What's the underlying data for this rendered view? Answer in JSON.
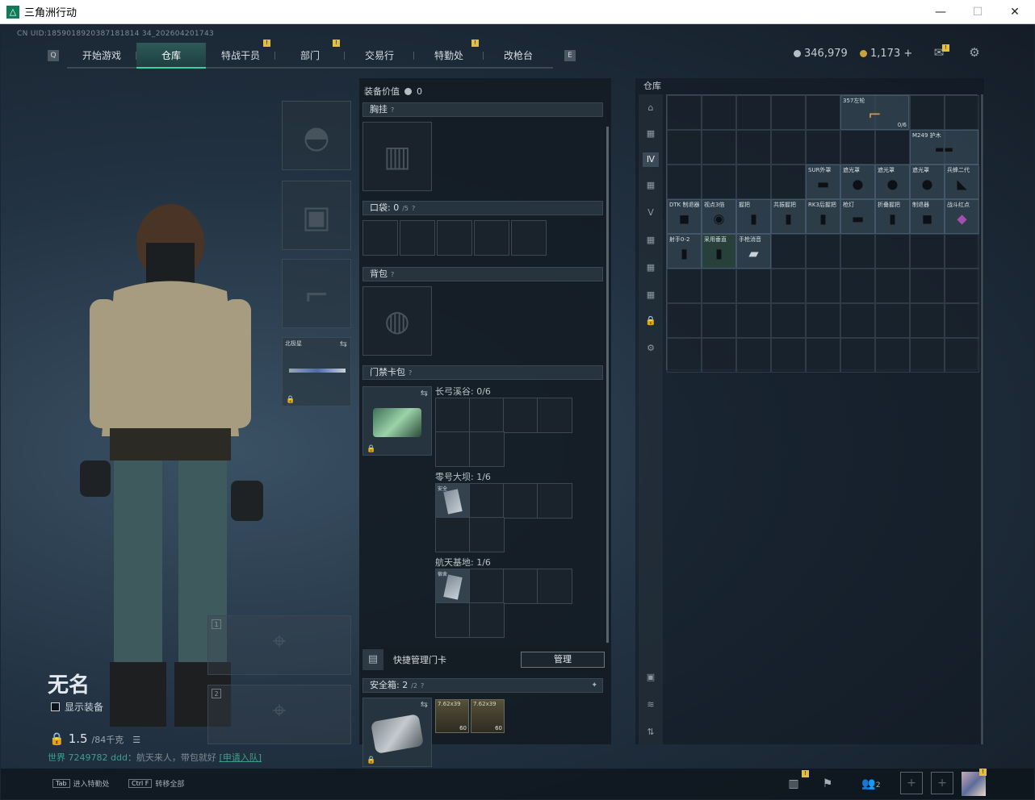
{
  "window": {
    "title": "三角洲行动",
    "logo": "△",
    "minimize": "—",
    "maximize": "☐",
    "close": "✕"
  },
  "uid": "CN UID:1859018920387181814 34_202604201743",
  "nav": {
    "tabs": [
      {
        "label": "开始游戏",
        "badge": ""
      },
      {
        "label": "仓库",
        "badge": "",
        "active": true
      },
      {
        "label": "特战干员",
        "badge": "!"
      },
      {
        "label": "部门",
        "badge": "!"
      },
      {
        "label": "交易行",
        "badge": ""
      },
      {
        "label": "特勤处",
        "badge": "!"
      },
      {
        "label": "改枪台",
        "badge": ""
      }
    ],
    "left_key": "Q",
    "right_key": "E"
  },
  "currency": {
    "silver": "346,979",
    "gold": "1,173 +"
  },
  "colors": {
    "accent": "#38d0a0",
    "badge": "#e3c03c"
  },
  "character": {
    "name": "无名",
    "show_equipment_label": "显示装备",
    "weight": "1.5",
    "weight_max": "/84千克",
    "chat_prefix": "世界",
    "chat_user": "7249782 ddd",
    "chat_msg": "：航天来人，带包就好",
    "chat_link": "[申请入队]",
    "melee_name": "北极星",
    "weapon_slot1": "1",
    "weapon_slot2": "2"
  },
  "mid": {
    "equip_value_label": "装备价值",
    "equip_value": "0",
    "chest_label": "胸挂",
    "pocket_label": "口袋:",
    "pocket_count": "0",
    "pocket_max": "/5",
    "backpack_label": "背包",
    "keycard_label": "门禁卡包",
    "sections": [
      {
        "label": "长弓溪谷:",
        "count": "0/6"
      },
      {
        "label": "零号大坝:",
        "count": "1/6"
      },
      {
        "label": "航天基地:",
        "count": "1/6"
      }
    ],
    "card_label": "安全",
    "card_label2": "宿舍",
    "quick_manage_label": "快捷管理门卡",
    "manage_button": "管理",
    "safebox_label": "安全箱:",
    "safebox_count": "2",
    "safebox_max": "/2",
    "ammo": [
      {
        "label": "7.62x39",
        "count": "60"
      },
      {
        "label": "7.62x39",
        "count": "60"
      }
    ]
  },
  "storage": {
    "title": "仓库",
    "items": [
      {
        "label": "357左轮",
        "count": "0/6"
      },
      {
        "label": "M249 护木",
        "count": ""
      },
      {
        "label": "SUR外罩",
        "count": ""
      },
      {
        "label": "遮光罩",
        "count": ""
      },
      {
        "label": "遮光罩",
        "count": ""
      },
      {
        "label": "遮光罩",
        "count": ""
      },
      {
        "label": "兵蜂二代",
        "count": ""
      },
      {
        "label": "DTK 制退器",
        "count": ""
      },
      {
        "label": "视点3倍",
        "count": ""
      },
      {
        "label": "握把",
        "count": ""
      },
      {
        "label": "共振握把",
        "count": ""
      },
      {
        "label": "RK3后握把",
        "count": ""
      },
      {
        "label": "枪灯",
        "count": ""
      },
      {
        "label": "折叠握把",
        "count": ""
      },
      {
        "label": "制退器",
        "count": ""
      },
      {
        "label": "战斗红点",
        "count": ""
      },
      {
        "label": "射手0-2",
        "count": ""
      },
      {
        "label": "采用垂直",
        "count": ""
      },
      {
        "label": "手枪消音",
        "count": ""
      }
    ]
  },
  "bottom": {
    "hint1_key": "Tab",
    "hint1": "进入特勤处",
    "hint2_key": "Ctrl F",
    "hint2": "转移全部",
    "squad_count": "2"
  }
}
